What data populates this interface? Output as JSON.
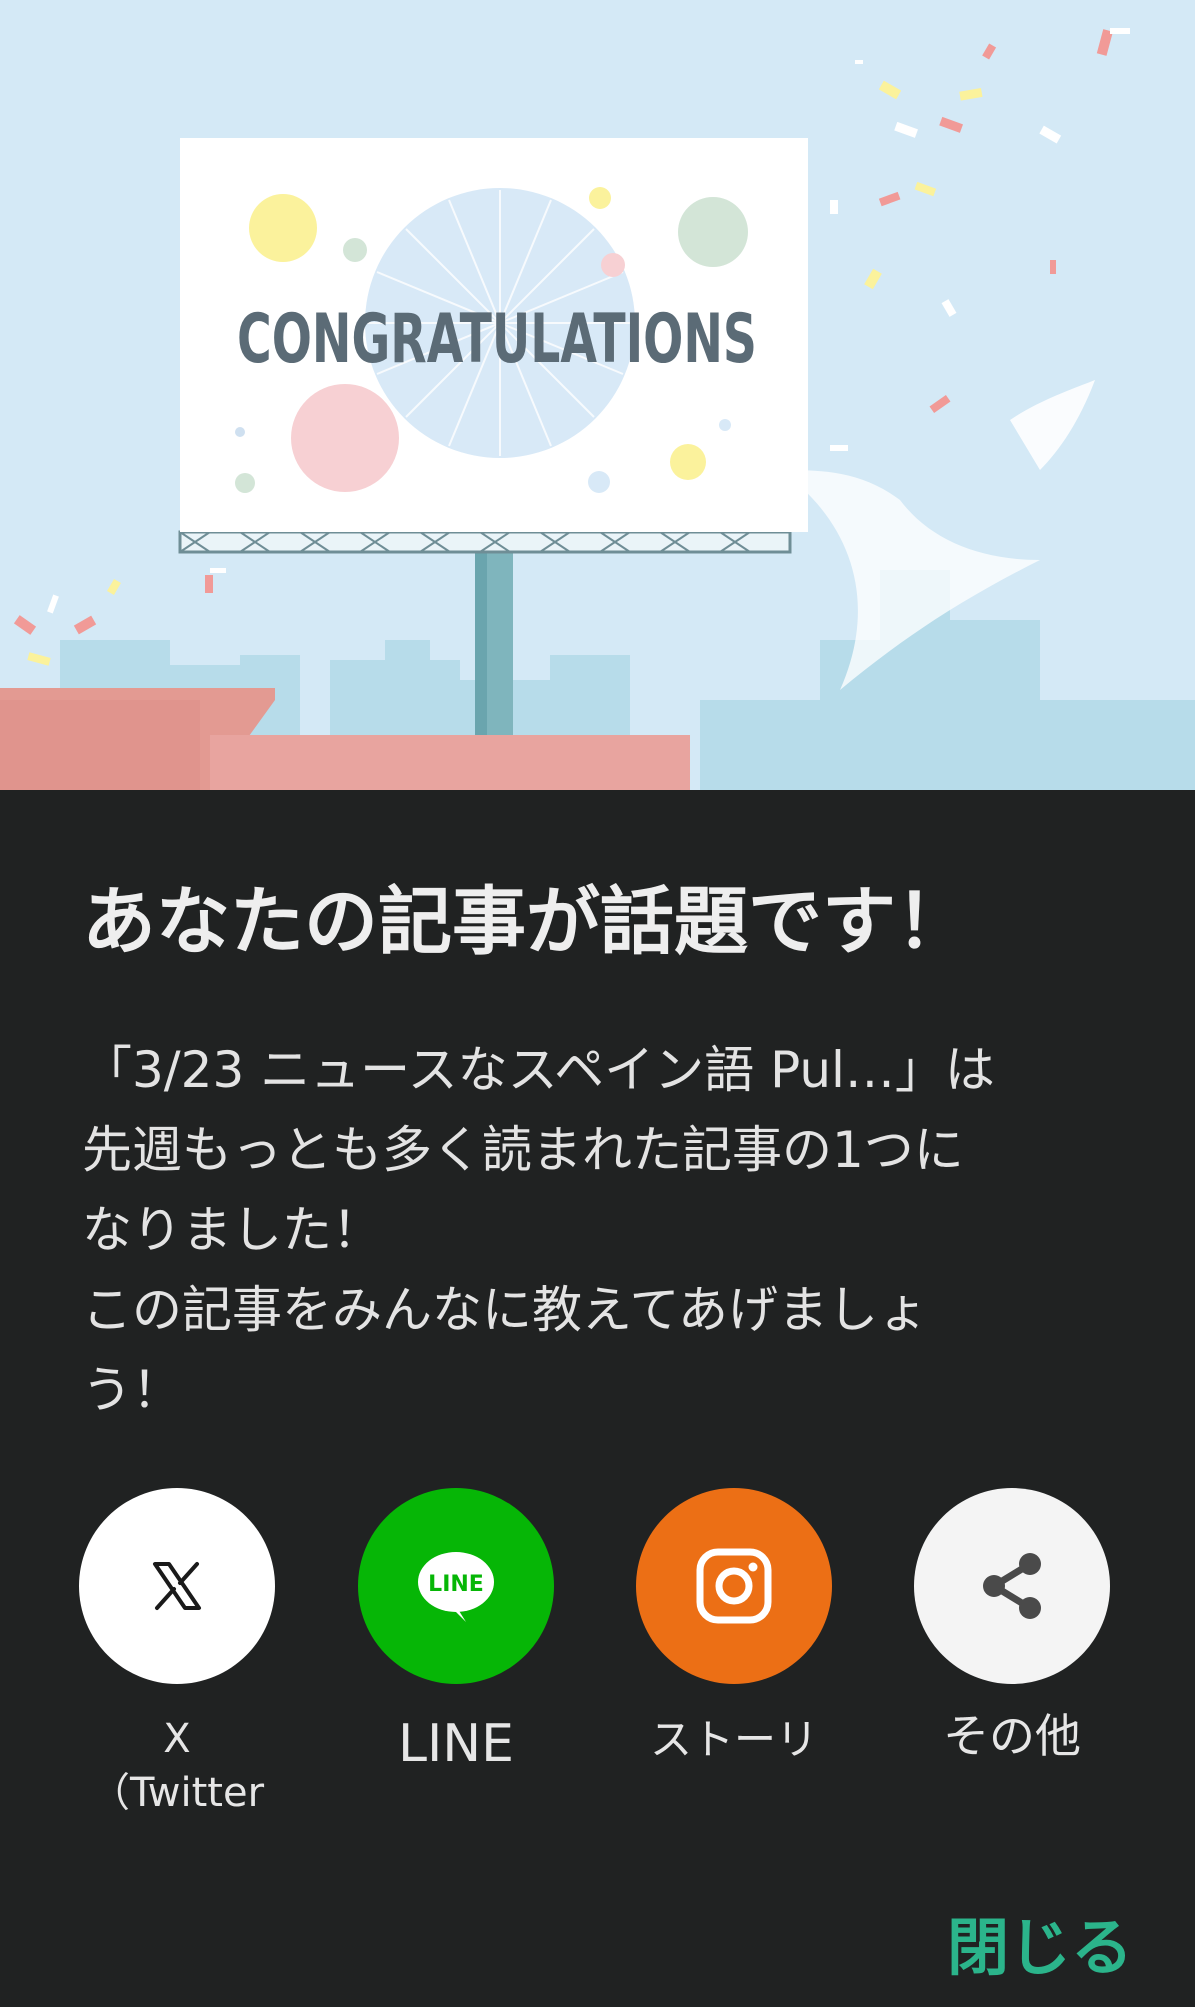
{
  "hero": {
    "billboard_text": "CONGRATULATIONS"
  },
  "dialog": {
    "title": "あなたの記事が話題です！",
    "body_lines": [
      "「3/23 ニュースなスペイン語 Pul…」は",
      "先週もっとも多く読まれた記事の1つに",
      "なりました！",
      "この記事をみんなに教えてあげましょ",
      "う！"
    ]
  },
  "share": {
    "items": [
      {
        "name": "x",
        "label_line1": "X",
        "label_line2": "（Twitter",
        "icon": "x-logo-icon",
        "bg": "#ffffff"
      },
      {
        "name": "line",
        "label_line1": "LINE",
        "icon_text": "LINE",
        "icon": "line-logo-icon",
        "bg": "#06b606"
      },
      {
        "name": "story",
        "label_line1": "ストーリ",
        "icon": "instagram-icon",
        "bg": "#ec6f15"
      },
      {
        "name": "other",
        "label_line1": "その他",
        "icon": "share-icon",
        "bg": "#f4f4f4"
      }
    ]
  },
  "close_label": "閉じる",
  "colors": {
    "background": "#202222",
    "accent": "#2bb48b",
    "sky": "#d4e9f6",
    "text": "#e3e3e3"
  }
}
